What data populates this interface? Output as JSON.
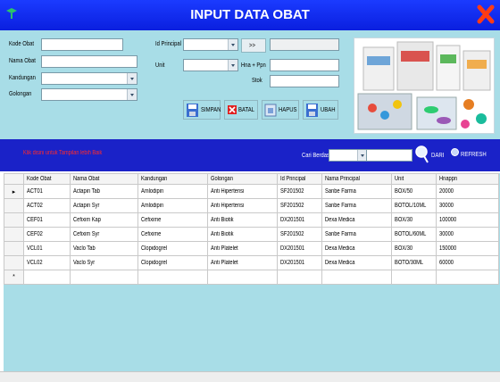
{
  "window": {
    "title": "INPUT DATA OBAT"
  },
  "form": {
    "kode_obat_label": "Kode Obat",
    "nama_obat_label": "Nama Obat",
    "kandungan_label": "Kandungan",
    "golongan_label": "Golongan",
    "id_principal_label": "Id Principal",
    "unit_label": "Unit",
    "hna_ppn_label": "Hna + Ppn",
    "stok_label": "Stok",
    "principal_button": ">>"
  },
  "buttons": {
    "simpan": "SIMPAN",
    "batal": "BATAL",
    "hapus": "HAPUS",
    "ubah": "UBAH"
  },
  "search": {
    "hint": "Klik disini untuk Tampilan lebih Baik",
    "label": "Cari Berdasarkan",
    "dari": "DARI",
    "refresh": "REFRESH"
  },
  "table": {
    "columns": [
      "Kode Obat",
      "Nama Obat",
      "Kandungan",
      "Golongan",
      "Id Principal",
      "Nama Principal",
      "Unit",
      "Hnappn"
    ],
    "rows": [
      [
        "ACT01",
        "Actapin Tab",
        "Amlodipin",
        "Anti Hipertensi",
        "SF201502",
        "Sanbe Farma",
        "BOX/50",
        "20000"
      ],
      [
        "ACT02",
        "Actapin Syr",
        "Amlodipin",
        "Anti Hipertensi",
        "SF201502",
        "Sanbe Farma",
        "BOTOL/10ML",
        "30000"
      ],
      [
        "CEF01",
        "Cefixim Kap",
        "Cefixime",
        "Anti Biotik",
        "DX201501",
        "Dexa Medica",
        "BOX/30",
        "100000"
      ],
      [
        "CEF02",
        "Cefixim Syr",
        "Cefixime",
        "Anti Biotik",
        "SF201502",
        "Sanbe Farma",
        "BOTOL/60ML",
        "30000"
      ],
      [
        "VCL01",
        "Vaclo Tab",
        "Clopidogrel",
        "Anti Platelet",
        "DX201501",
        "Dexa Medica",
        "BOX/30",
        "150000"
      ],
      [
        "VCL02",
        "Vaclo Syr",
        "Clopidogrel",
        "Anti Platelet",
        "DX201501",
        "Dexa Medica",
        "BOTO/30ML",
        "60000"
      ]
    ],
    "current_row_marker": "▸",
    "new_row_marker": "*"
  },
  "icons": {
    "app": "app-icon",
    "close": "close-icon",
    "search": "search-icon",
    "refresh": "refresh-icon"
  },
  "colors": {
    "titlebar": "#0a1fdf",
    "form_bg": "#a8dde7",
    "search_bar": "#1a22c8",
    "hint": "#ff2a2a",
    "close": "#ff3b14"
  }
}
